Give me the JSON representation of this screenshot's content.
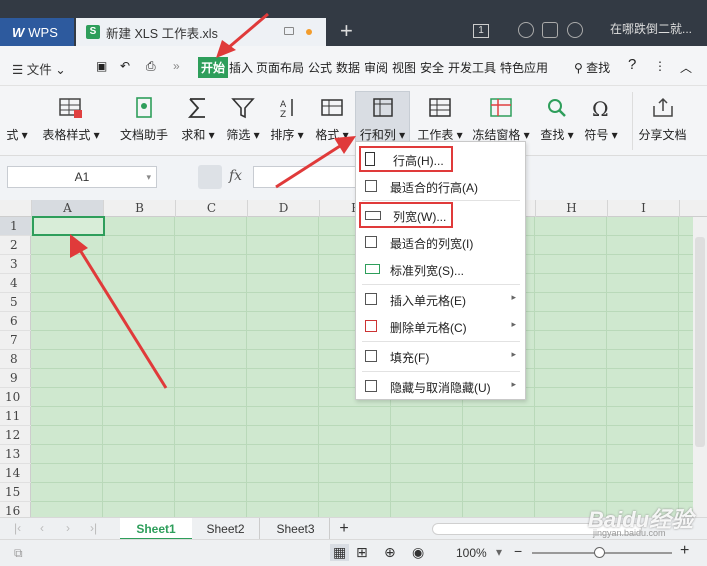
{
  "titlebar": {
    "wps_label": "WPS",
    "doc_title": "新建 XLS 工作表.xls",
    "badge": "1",
    "user": "在哪跌倒二就..."
  },
  "menubar": {
    "file": "文件",
    "tabs": [
      "开始",
      "插入",
      "页面布局",
      "公式",
      "数据",
      "审阅",
      "视图",
      "安全",
      "开发工具",
      "特色应用"
    ],
    "search": "查找",
    "help": "?"
  },
  "ribbon": {
    "items": [
      "式",
      "表格样式",
      "文档助手",
      "求和",
      "筛选",
      "排序",
      "格式",
      "行和列",
      "工作表",
      "冻结窗格",
      "查找",
      "符号",
      "分享文档"
    ]
  },
  "formula": {
    "cell": "A1",
    "fx": "fx"
  },
  "columns": [
    "A",
    "B",
    "C",
    "D",
    "E",
    "F",
    "G",
    "H",
    "I"
  ],
  "rows": [
    "1",
    "2",
    "3",
    "4",
    "5",
    "6",
    "7",
    "8",
    "9",
    "10",
    "11",
    "12",
    "13",
    "14",
    "15",
    "16"
  ],
  "context_menu": {
    "items": [
      {
        "label": "行高(H)..."
      },
      {
        "label": "最适合的行高(A)"
      },
      {
        "label": "列宽(W)..."
      },
      {
        "label": "最适合的列宽(I)"
      },
      {
        "label": "标准列宽(S)..."
      },
      {
        "label": "插入单元格(E)"
      },
      {
        "label": "删除单元格(C)"
      },
      {
        "label": "填充(F)"
      },
      {
        "label": "隐藏与取消隐藏(U)"
      }
    ]
  },
  "sheets": [
    "Sheet1",
    "Sheet2",
    "Sheet3"
  ],
  "status": {
    "zoom": "100%"
  },
  "watermark": "Baidu经验",
  "watermark_sub": "jingyan.baidu.com",
  "colors": {
    "accent": "#2e9e5b",
    "annotation": "#e03a3a"
  }
}
